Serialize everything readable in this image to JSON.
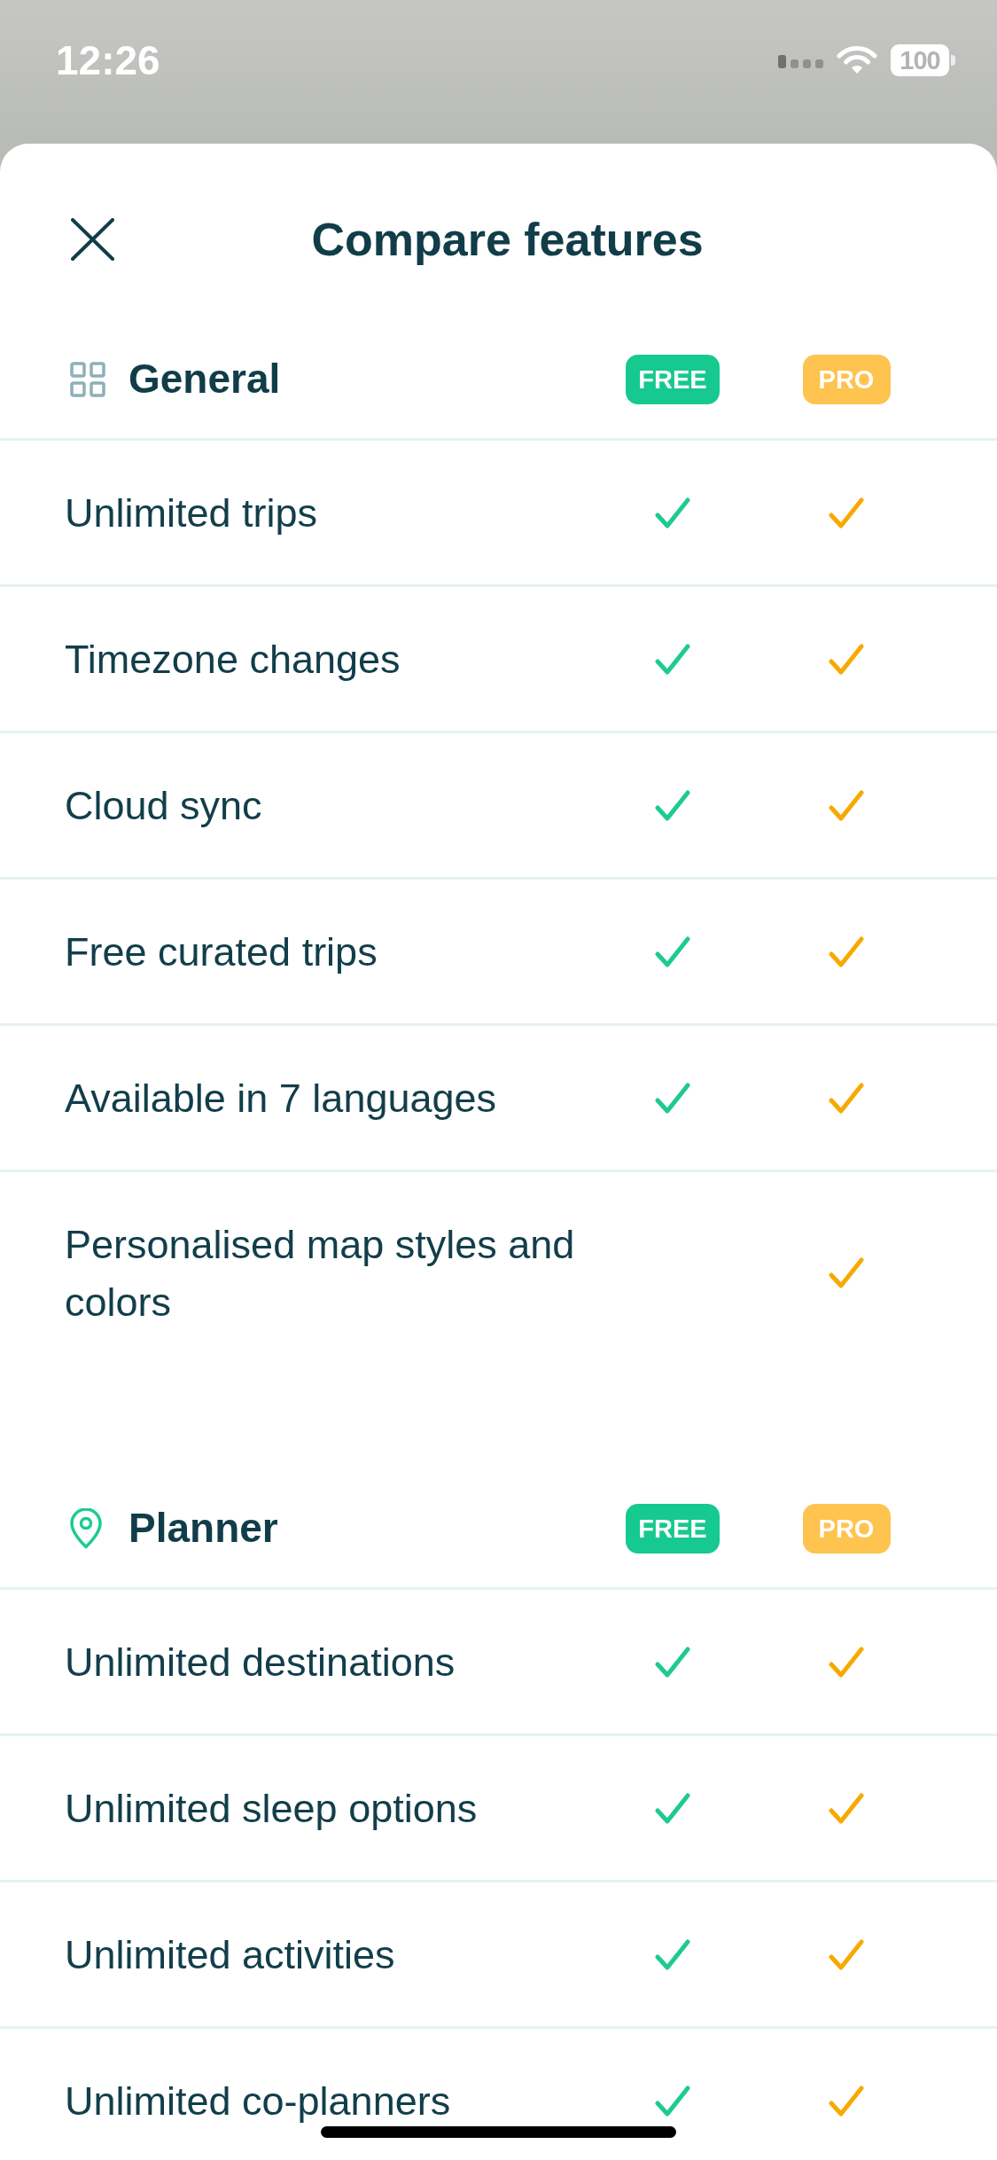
{
  "status_bar": {
    "time": "12:26",
    "battery": "100"
  },
  "header": {
    "title": "Compare features"
  },
  "sections": [
    {
      "kind": "grid",
      "title": "General",
      "plans": [
        {
          "label": "FREE",
          "color": "#16c98e"
        },
        {
          "label": "PRO",
          "color": "#ffc350"
        }
      ],
      "features": [
        {
          "name": "Unlimited trips",
          "included": [
            true,
            true
          ]
        },
        {
          "name": "Timezone changes",
          "included": [
            true,
            true
          ]
        },
        {
          "name": "Cloud sync",
          "included": [
            true,
            true
          ]
        },
        {
          "name": "Free curated trips",
          "included": [
            true,
            true
          ]
        },
        {
          "name": "Available in 7 languages",
          "included": [
            true,
            true
          ]
        },
        {
          "name": "Personalised map styles and colors",
          "included": [
            false,
            true
          ]
        }
      ]
    },
    {
      "kind": "pin",
      "title": "Planner",
      "plans": [
        {
          "label": "FREE",
          "color": "#16c98e"
        },
        {
          "label": "PRO",
          "color": "#ffc350"
        }
      ],
      "features": [
        {
          "name": "Unlimited destinations",
          "included": [
            true,
            true
          ]
        },
        {
          "name": "Unlimited sleep options",
          "included": [
            true,
            true
          ]
        },
        {
          "name": "Unlimited activities",
          "included": [
            true,
            true
          ]
        },
        {
          "name": "Unlimited co-planners",
          "included": [
            true,
            true
          ]
        }
      ]
    }
  ]
}
